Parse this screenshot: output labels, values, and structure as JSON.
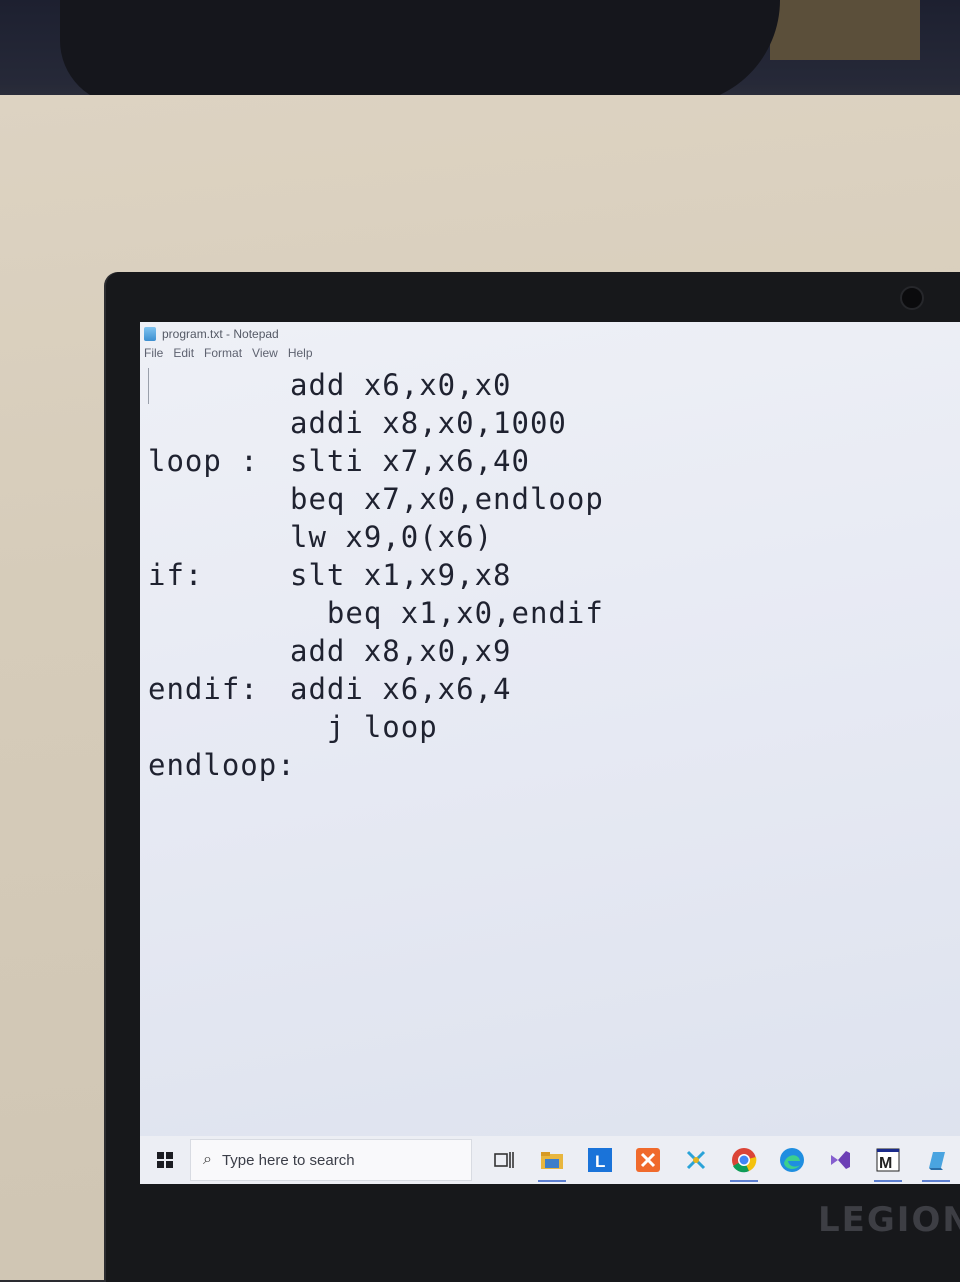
{
  "window": {
    "title": "program.txt - Notepad",
    "menu": [
      "File",
      "Edit",
      "Format",
      "View",
      "Help"
    ]
  },
  "editor": {
    "lines": [
      {
        "label": "",
        "code": "add x6,x0,x0"
      },
      {
        "label": "",
        "code": "addi x8,x0,1000"
      },
      {
        "label": "loop :",
        "code": "slti x7,x6,40"
      },
      {
        "label": "",
        "code": "beq x7,x0,endloop"
      },
      {
        "label": "",
        "code": "lw x9,0(x6)"
      },
      {
        "label": "if:",
        "code": "slt x1,x9,x8"
      },
      {
        "label": "",
        "code": "  beq x1,x0,endif"
      },
      {
        "label": "",
        "code": "add x8,x0,x9"
      },
      {
        "label": "endif:",
        "code": "addi x6,x6,4"
      },
      {
        "label": "",
        "code": "  j loop"
      },
      {
        "label": "endloop:",
        "code": ""
      }
    ]
  },
  "taskbar": {
    "search_placeholder": "Type here to search",
    "icons": [
      "start-icon",
      "task-view-icon",
      "file-explorer-icon",
      "lenovo-vantage-icon",
      "xampp-icon",
      "xcode-like-icon",
      "chrome-icon",
      "edge-icon",
      "visual-studio-icon",
      "mars-icon",
      "notepad-icon"
    ]
  },
  "device": {
    "brand": "LEGION"
  },
  "colors": {
    "accent": "#5d7fd0",
    "text": "#1f2230"
  }
}
